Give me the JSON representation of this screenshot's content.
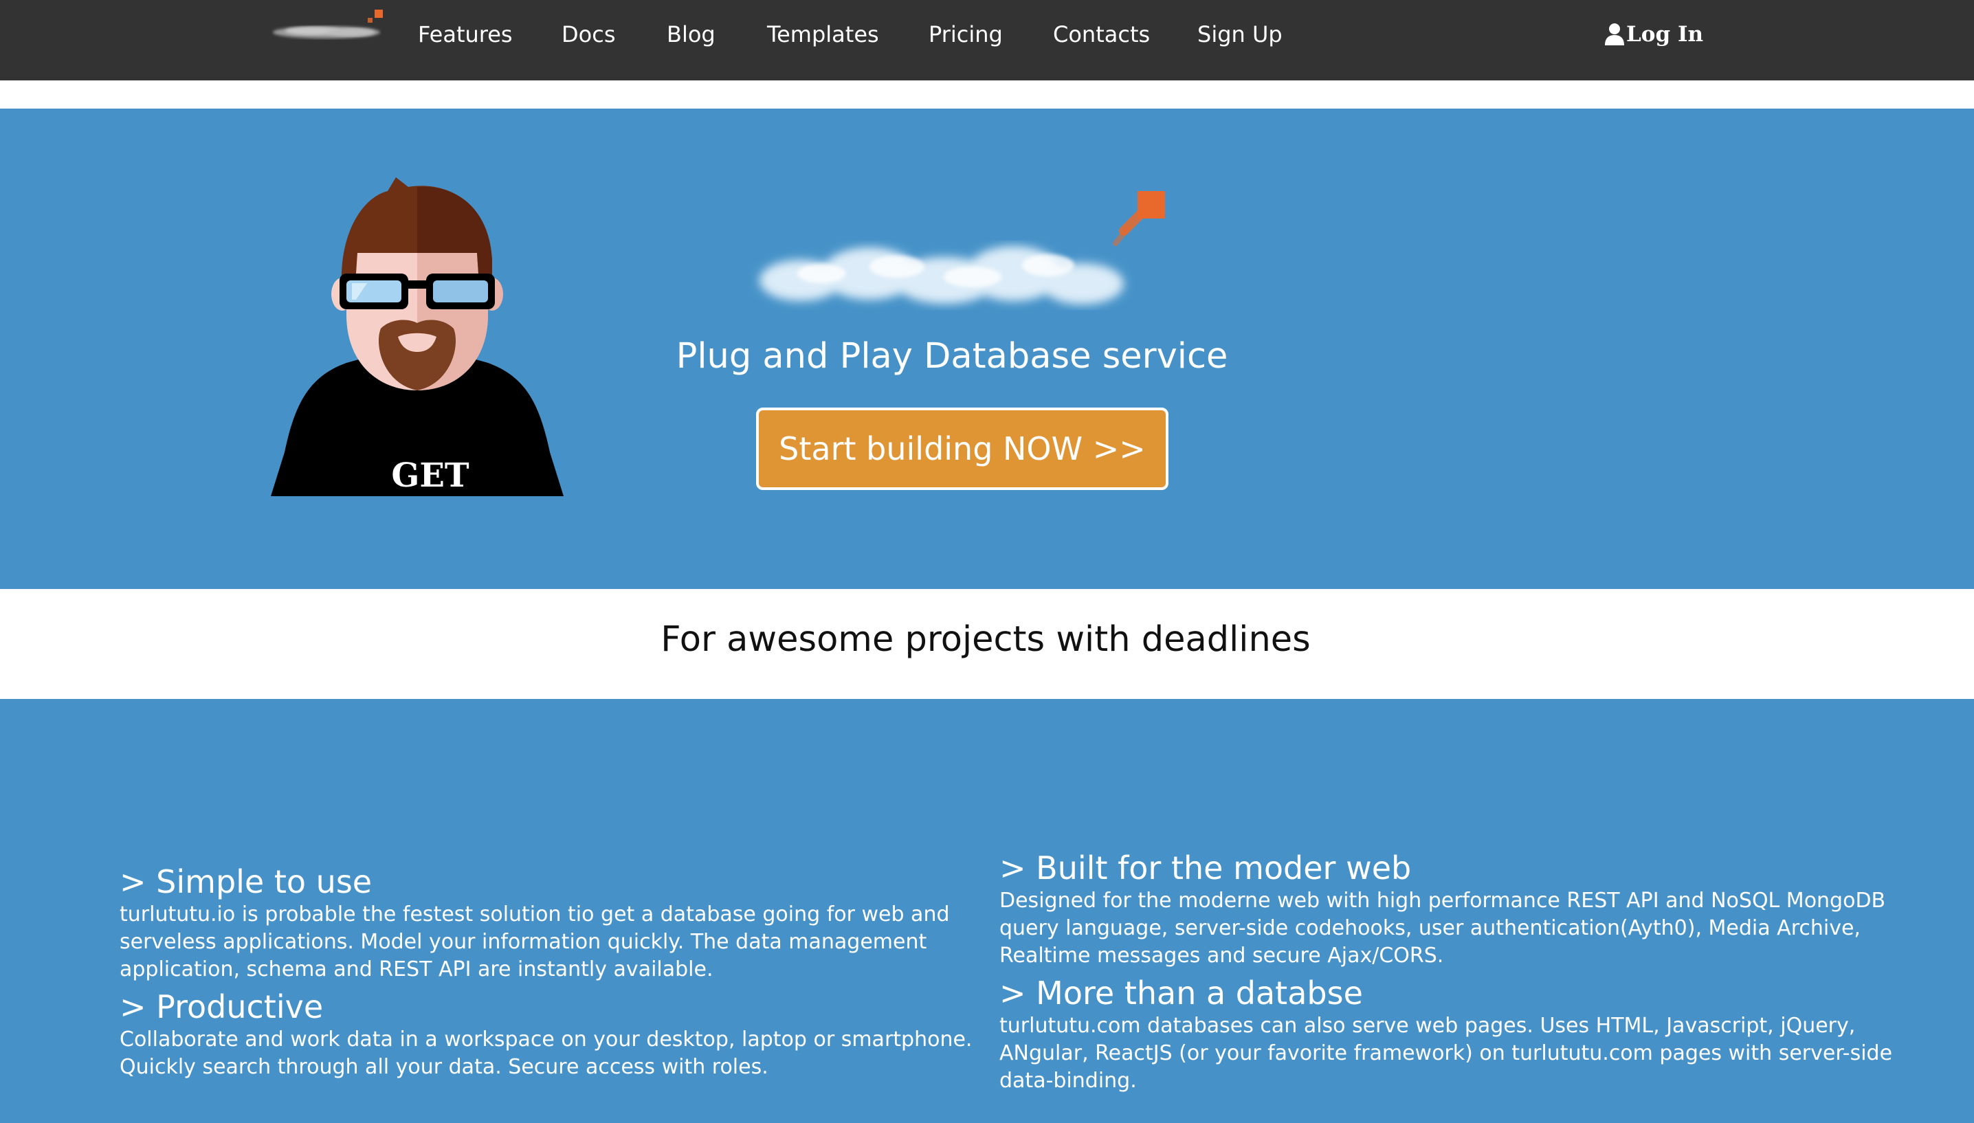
{
  "nav": {
    "items": [
      {
        "label": "Features"
      },
      {
        "label": "Docs"
      },
      {
        "label": "Blog"
      },
      {
        "label": "Templates"
      },
      {
        "label": "Pricing"
      },
      {
        "label": "Contacts"
      },
      {
        "label": "Sign Up"
      }
    ],
    "login_label": "Log In",
    "login_icon": "user-icon"
  },
  "hero": {
    "avatar_shirt_text": "GET",
    "tagline": "Plug and Play Database service",
    "cta_label": "Start building NOW >>"
  },
  "band": {
    "text": "For awesome projects with deadlines"
  },
  "features": [
    {
      "title": "> Simple to use",
      "body": "turlututu.io is probable the festest solution tio get a database going for web and serveless applications. Model your information quickly. The data management application, schema and REST API are instantly available."
    },
    {
      "title": "> Productive",
      "body": "Collaborate and work data in a workspace on your desktop, laptop or smartphone. Quickly search through all your data. Secure access with roles."
    },
    {
      "title": "> Built for the moder web",
      "body": "Designed for the moderne web with high performance REST API and NoSQL MongoDB query language, server-side codehooks, user authentication(Ayth0), Media Archive, Realtime messages and secure Ajax/CORS."
    },
    {
      "title": "> More than a databse",
      "body": "turlututu.com databases can also serve web pages. Uses HTML, Javascript, jQuery, ANgular, ReactJS (or your favorite framework) on turlututu.com pages with server-side data-binding."
    }
  ],
  "colors": {
    "nav_bg": "#333333",
    "hero_bg": "#4692c8",
    "cta_bg": "#e09535",
    "accent_orange": "#e8692b"
  }
}
